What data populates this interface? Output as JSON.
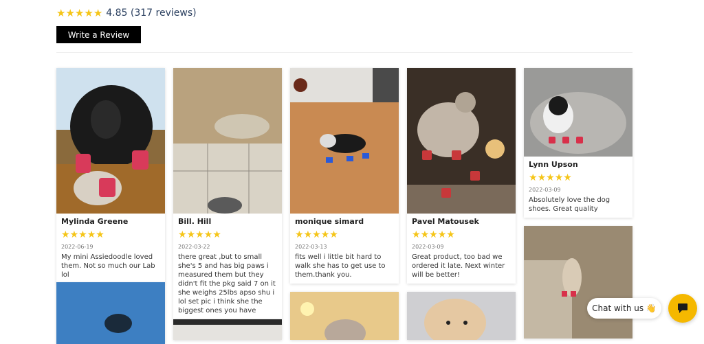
{
  "summary": {
    "rating_text": "4.85 (317 reviews)",
    "star_color": "#f5c518"
  },
  "actions": {
    "write_review": "Write a Review"
  },
  "reviews": [
    {
      "author": "Mylinda Greene",
      "date": "2022-06-19",
      "text": "My mini Assiedoodle loved them. Not so much our Lab lol",
      "photo": "dog-photo"
    },
    {
      "author": "Bill. Hill",
      "date": "2022-03-22",
      "text": "there great ,but to small she's 5 and has big paws i measured them but they didn't fit the pkg said 7 on it she weighs 25lbs apso shu i lol set pic i think she the biggest ones you have",
      "photo": "dog-photo"
    },
    {
      "author": "monique simard",
      "date": "2022-03-13",
      "text": "fits well i little bit hard to walk she has to get use to them.thank you.",
      "photo": "dog-photo"
    },
    {
      "author": "Pavel Matousek",
      "date": "2022-03-09",
      "text": "Great product, too bad we ordered it late. Next winter will be better!",
      "photo": "dog-photo"
    },
    {
      "author": "Lynn Upson",
      "date": "2022-03-09",
      "text": "Absolutely love the dog shoes. Great quality",
      "photo": "dog-photo"
    }
  ],
  "chat": {
    "label": "Chat with us 👋",
    "accent": "#f5b800"
  }
}
